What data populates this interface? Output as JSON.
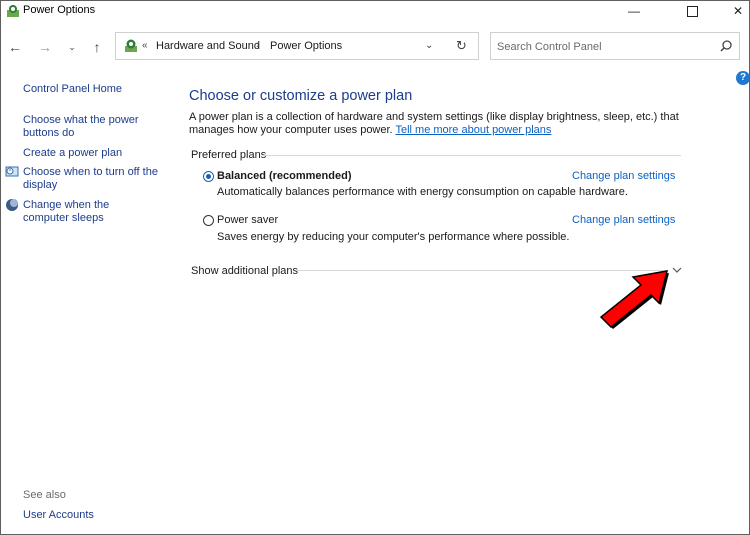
{
  "window": {
    "title": "Power Options"
  },
  "titlebar_controls": {
    "minimize": "—",
    "close": "✕"
  },
  "nav": {
    "back_glyph": "←",
    "forward_glyph": "→",
    "recent_glyph": "⌄",
    "up_glyph": "↑",
    "breadcrumb_prefix": "«",
    "breadcrumbs": [
      "Hardware and Sound",
      "Power Options"
    ],
    "breadcrumb_separator": "›",
    "dropdown_glyph": "⌄",
    "refresh_glyph": "↻"
  },
  "search": {
    "placeholder": "Search Control Panel"
  },
  "help": {
    "glyph": "?"
  },
  "sidebar": {
    "home_label": "Control Panel Home",
    "links": [
      "Choose what the power buttons do",
      "Create a power plan",
      "Choose when to turn off the display",
      "Change when the computer sleeps"
    ],
    "see_also_label": "See also",
    "see_also_links": [
      "User Accounts"
    ]
  },
  "main": {
    "title": "Choose or customize a power plan",
    "description": "A power plan is a collection of hardware and system settings (like display brightness, sleep, etc.) that manages how your computer uses power.",
    "learn_more_link": "Tell me more about power plans",
    "preferred_plans_label": "Preferred plans",
    "plans": [
      {
        "name": "Balanced (recommended)",
        "description": "Automatically balances performance with energy consumption on capable hardware.",
        "selected": true,
        "settings_link": "Change plan settings"
      },
      {
        "name": "Power saver",
        "description": "Saves energy by reducing your computer's performance where possible.",
        "selected": false,
        "settings_link": "Change plan settings"
      }
    ],
    "show_additional_label": "Show additional plans"
  },
  "colors": {
    "link": "#0b61c4",
    "heading": "#1c3c8c",
    "annotation_arrow": "#ff0000"
  }
}
